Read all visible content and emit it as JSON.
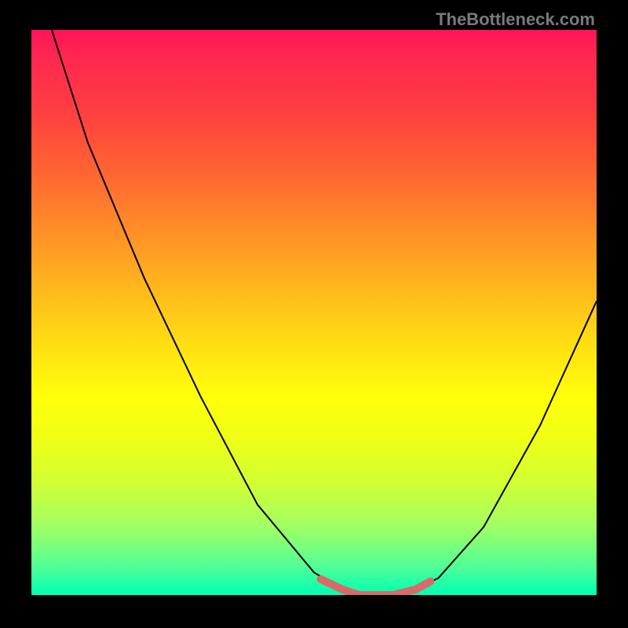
{
  "watermark": "TheBottleneck.com",
  "chart_data": {
    "type": "line",
    "title": "",
    "xlabel": "",
    "ylabel": "",
    "xlim": [
      0,
      1
    ],
    "ylim": [
      0,
      1
    ],
    "background_gradient": {
      "top": "#ff1458",
      "bottom": "#00ffb4",
      "stops": [
        "#ff1458",
        "#ff2850",
        "#ff4040",
        "#ff6432",
        "#ff8c28",
        "#ffb41e",
        "#ffdc14",
        "#ffff0a",
        "#f0ff14",
        "#d2ff32",
        "#a0ff64",
        "#50ff96",
        "#00ffb4"
      ]
    },
    "series": [
      {
        "name": "bottleneck-curve",
        "stroke": "#000000",
        "x": [
          0.036,
          0.1,
          0.2,
          0.3,
          0.4,
          0.5,
          0.55,
          0.58,
          0.6,
          0.64,
          0.68,
          0.72,
          0.8,
          0.9,
          1.0
        ],
        "y": [
          1.0,
          0.8,
          0.56,
          0.35,
          0.16,
          0.04,
          0.01,
          0.0,
          0.0,
          0.0,
          0.01,
          0.03,
          0.12,
          0.3,
          0.52
        ]
      },
      {
        "name": "bottleneck-highlight",
        "stroke": "#d86a6a",
        "x": [
          0.512,
          0.55,
          0.58,
          0.6,
          0.64,
          0.68,
          0.706
        ],
        "y": [
          0.028,
          0.01,
          0.0,
          0.0,
          0.0,
          0.01,
          0.024
        ]
      }
    ]
  }
}
